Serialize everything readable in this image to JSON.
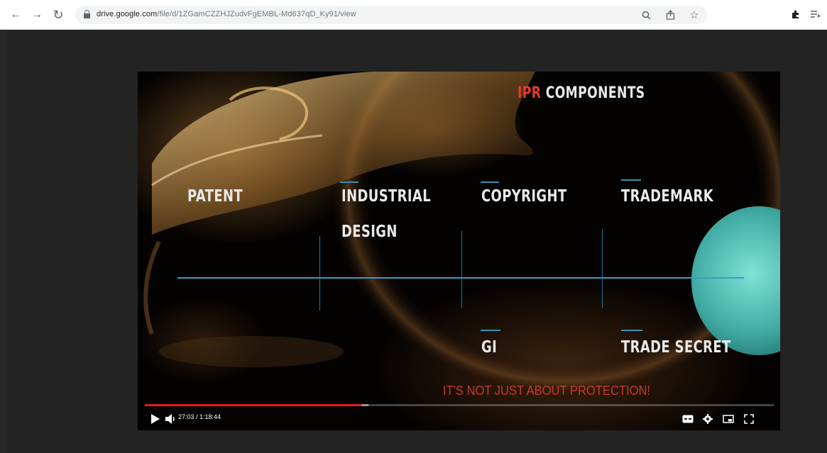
{
  "browser": {
    "url_host": "drive.google.com",
    "url_path": "/file/d/1ZGamCZZHJZudvFgEMBL-Md637qD_Ky91/view",
    "icons": [
      "back-arrow-icon",
      "forward-arrow-icon",
      "reload-icon",
      "lock-icon",
      "zoom-icon",
      "share-icon",
      "star-icon",
      "extensions-icon",
      "playlist-icon"
    ]
  },
  "slide": {
    "title_accent": "IPR",
    "title_rest": "COMPONENTS",
    "labels": {
      "patent": "PATENT",
      "industrial_design_1": "INDUSTRIAL",
      "industrial_design_2": "DESIGN",
      "copyright": "COPYRIGHT",
      "trademark": "TRADEMARK",
      "gi": "GI",
      "trade_secret": "TRADE SECRET"
    },
    "tagline": "IT'S NOT JUST ABOUT PROTECTION!"
  },
  "player": {
    "time": "27:03 / 1:18:44",
    "progress_played_fraction": 0.344,
    "progress_buffered_fraction": 0.355,
    "colors": {
      "accent": "#e83a2c",
      "progress": "#e21b1b",
      "line": "#3e9bc0",
      "teal": "#4fb8b0"
    }
  }
}
